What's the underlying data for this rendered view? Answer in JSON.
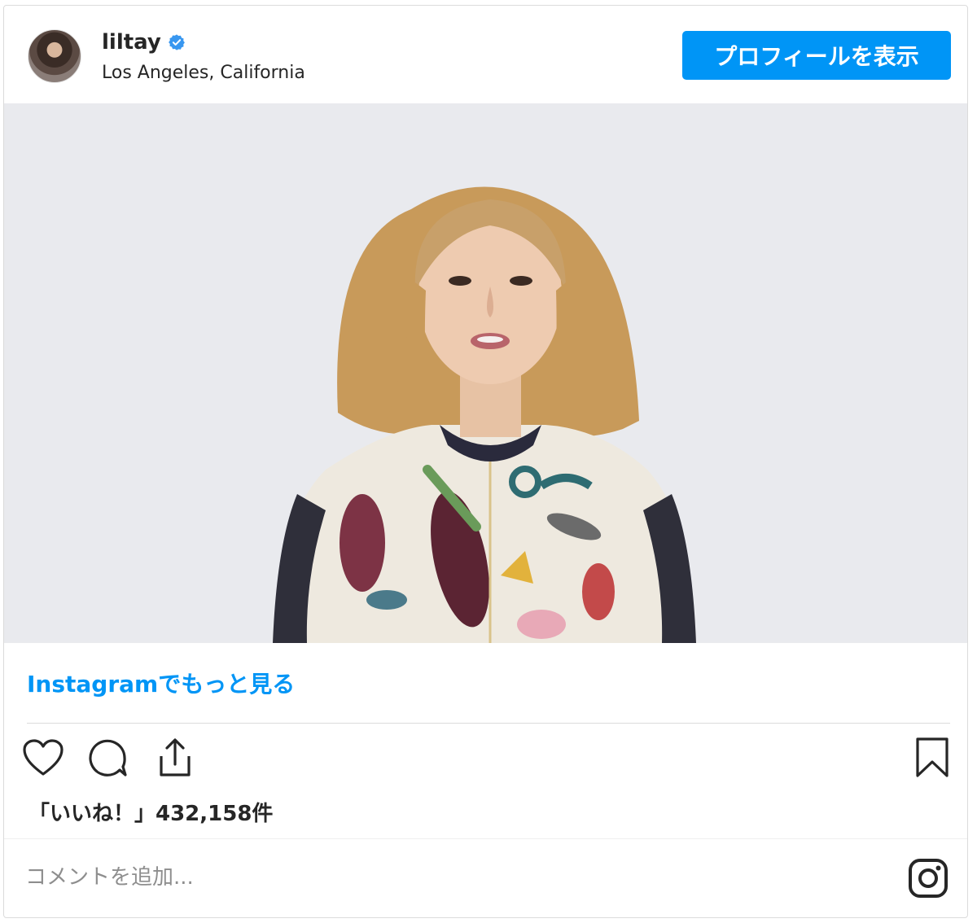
{
  "post": {
    "username": "liltay",
    "location": "Los Angeles, California",
    "profile_button": "プロフィールを表示",
    "more_link": "Instagramでもっと見る",
    "likes_text": "「いいね！」432,158件",
    "comment_placeholder": "コメントを追加..."
  },
  "icons": {
    "verified": "verified-badge-icon",
    "like": "heart-icon",
    "comment": "comment-bubble-icon",
    "share": "share-icon",
    "save": "bookmark-icon",
    "instagram": "instagram-logo-icon"
  },
  "colors": {
    "accent": "#0095f6",
    "text": "#262626",
    "muted": "#8e8e8e",
    "media_bg": "#e9eaee"
  }
}
